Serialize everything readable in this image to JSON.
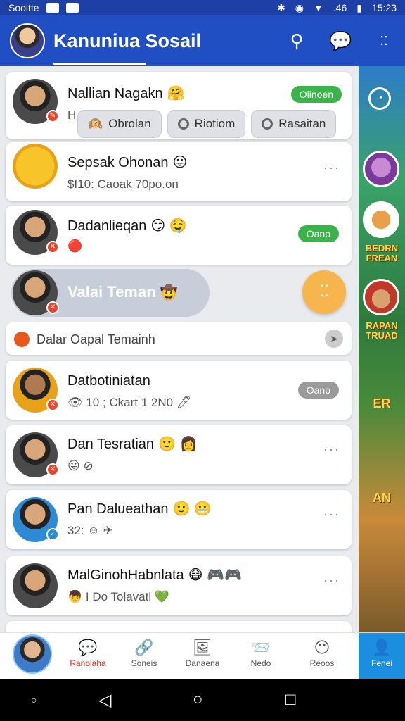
{
  "status_bar": {
    "carrier": "Sooitte",
    "signal": ".46",
    "time": "15:23"
  },
  "app_bar": {
    "title": "Kanuniua Sosail",
    "search_icon": "search-icon",
    "chat_icon": "chat-bubble-icon",
    "grid_icon": "grid-icon"
  },
  "filters": [
    {
      "label": "Obrolan",
      "icon": "emoji-icon"
    },
    {
      "label": "Riotiom",
      "icon": "circle-icon"
    },
    {
      "label": "Rasaitan",
      "icon": "circle-icon"
    }
  ],
  "chats": [
    {
      "name": "Nallian Nagakn",
      "emoji": "🤗",
      "sub": "H",
      "pill": "Oiinoen",
      "pill_color": "#3bb34a"
    },
    {
      "name": "Sepsak Ohonan",
      "emoji": "😛",
      "sub": "$f10: Caoak 70po.on",
      "more": "···"
    },
    {
      "name": "Dadanlieqan",
      "emoji": "😏 🤤",
      "sub": "🔴",
      "pill": "Oano",
      "pill_color": "#3bb34a"
    },
    {
      "name": "Datbotiniatan",
      "emoji": "",
      "sub": "👁 10 ; Ckart 1 2N0 🖊",
      "pill": "Oano",
      "pill_color": "#9a9a9a"
    },
    {
      "name": "Dan Tesratian",
      "emoji": "🙂 👩",
      "sub": "😛 ⊘",
      "more": "···"
    },
    {
      "name": "Pan Dalueathan",
      "emoji": "🙂 😬",
      "sub": "32: ☺ ✈",
      "more": "···"
    },
    {
      "name": "MalGinohHabnlata",
      "emoji": "😷 🎮🎮",
      "sub": "👦 I Do Tolavatl 💚",
      "more": "···"
    }
  ],
  "mid_banner": {
    "label": "Valai Teman",
    "emoji": "🤠"
  },
  "search": {
    "placeholder": "Dalar Oapal Temainh"
  },
  "fab_icon": "dots-icon",
  "side": {
    "label1": "BEDRN FREAN",
    "label2": "RAPAN TRUAD",
    "label3": "ER",
    "label4": "AN"
  },
  "bottom_nav": [
    {
      "label": "Ranolaha",
      "icon": "chat-heart-icon"
    },
    {
      "label": "Soneis",
      "icon": "link-icon"
    },
    {
      "label": "Danaena",
      "icon": "photo-icon"
    },
    {
      "label": "Nedo",
      "icon": "notification-icon"
    },
    {
      "label": "Reoos",
      "icon": "smile-icon"
    },
    {
      "label": "Fenei",
      "icon": "user-icon"
    }
  ],
  "colors": {
    "brand": "#1f4fc2",
    "accent": "#1b8ee0",
    "active": "#d8261b",
    "fab": "#f6b64d"
  }
}
